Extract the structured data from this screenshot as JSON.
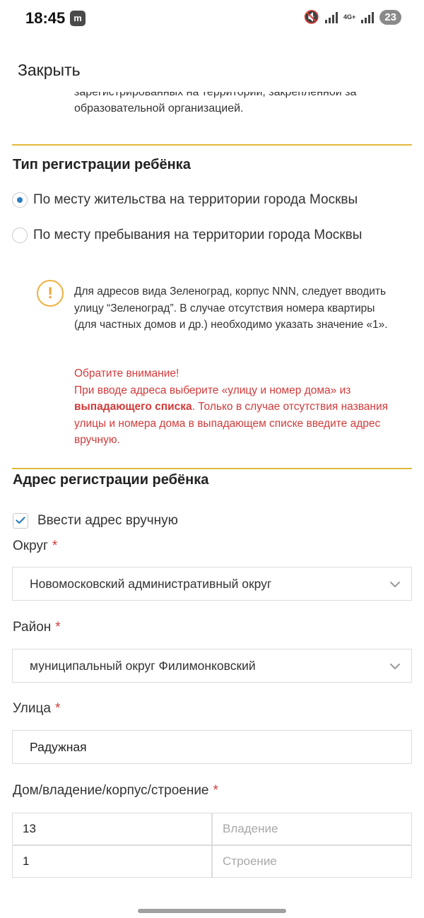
{
  "status_bar": {
    "time": "18:45",
    "app_icon_glyph": "m",
    "network": "4G+",
    "notification_count": "23"
  },
  "header": {
    "close_label": "Закрыть"
  },
  "clipped_text": {
    "line1": "зарегистрированных на территории, закрепленной за",
    "line2": "образовательной организацией."
  },
  "registration_type": {
    "title": "Тип регистрации ребёнка",
    "options": [
      {
        "label": "По месту жительства на территории города Москвы",
        "checked": true
      },
      {
        "label": "По месту пребывания на территории города Москвы",
        "checked": false
      }
    ]
  },
  "notice": {
    "icon_symbol": "!",
    "text": "Для адресов вида Зеленоград, корпус NNN, следует вводить улицу “Зеленоград”. В случае отсутствия номера квартиры (для частных домов и др.) необходимо указать значение «1».",
    "warning_title": "Обратите внимание!",
    "warning_part1": "При вводе адреса выберите «улицу и номер дома» из ",
    "warning_bold": "выпадающего списка",
    "warning_part2": ". Только в случае отсутствия названия улицы и номера дома в выпадающем списке введите адрес вручную."
  },
  "address": {
    "title": "Адрес регистрации ребёнка",
    "manual_checkbox_label": "Ввести адрес вручную",
    "manual_checked": true,
    "okrug_label": "Округ",
    "okrug_value": "Новомосковский административный округ",
    "rayon_label": "Район",
    "rayon_value": "муниципальный округ Филимонковский",
    "street_label": "Улица",
    "street_value": "Радужная",
    "house_label": "Дом/владение/корпус/строение",
    "house_value": "13",
    "vladenie_placeholder": "Владение",
    "korpus_value": "1",
    "stroenie_placeholder": "Строение",
    "required_mark": "*"
  },
  "colors": {
    "accent_divider": "#e2b93b",
    "radio_checked": "#2d7ec4",
    "required": "#d33a3a",
    "warning_icon": "#f0b03f"
  }
}
